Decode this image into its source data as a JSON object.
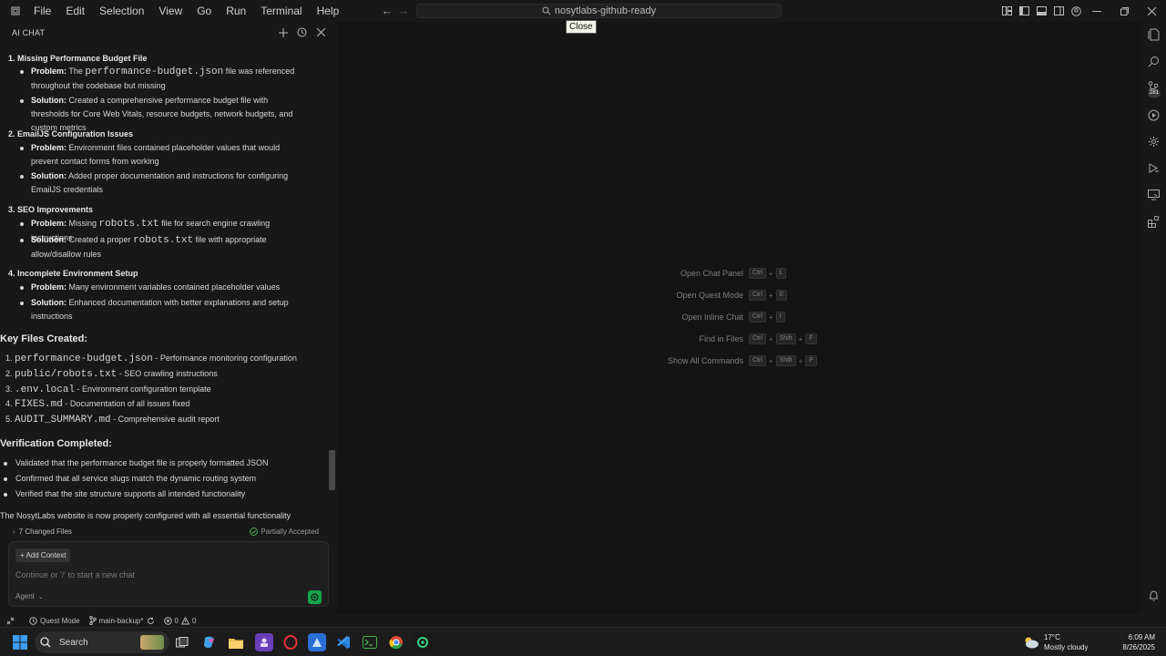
{
  "menu": [
    "File",
    "Edit",
    "Selection",
    "View",
    "Go",
    "Run",
    "Terminal",
    "Help"
  ],
  "search": {
    "text": "nosytlabs-github-ready"
  },
  "tooltip": "Close",
  "chat": {
    "header": "AI CHAT",
    "issues": [
      {
        "num": "1.",
        "title": "Missing Performance Budget File",
        "problem_label": "Problem:",
        "problem_pre": "The ",
        "problem_code": "performance-budget.json",
        "problem_post": " file was referenced throughout the codebase but missing",
        "solution_label": "Solution:",
        "solution": "Created a comprehensive performance budget file with thresholds for Core Web Vitals, resource budgets, network budgets, and custom metrics"
      },
      {
        "num": "2.",
        "title": "EmailJS Configuration Issues",
        "problem_label": "Problem:",
        "problem_pre": "Environment files contained placeholder values that would prevent contact forms from working",
        "problem_code": "",
        "problem_post": "",
        "solution_label": "Solution:",
        "solution": "Added proper documentation and instructions for configuring EmailJS credentials"
      },
      {
        "num": "3.",
        "title": "SEO Improvements",
        "problem_label": "Problem:",
        "problem_pre": "Missing ",
        "problem_code": "robots.txt",
        "problem_post": " file for search engine crawling instructions",
        "solution_label": "Solution:",
        "solution_pre": "Created a proper ",
        "solution_code": "robots.txt",
        "solution_post": " file with appropriate allow/disallow rules"
      },
      {
        "num": "4.",
        "title": "Incomplete Environment Setup",
        "problem_label": "Problem:",
        "problem_pre": "Many environment variables contained placeholder values",
        "problem_code": "",
        "problem_post": "",
        "solution_label": "Solution:",
        "solution": "Enhanced documentation with better explanations and setup instructions"
      }
    ],
    "key_files_title": "Key Files Created:",
    "key_files": [
      {
        "num": "1.",
        "code": "performance-budget.json",
        "desc": " - Performance monitoring configuration"
      },
      {
        "num": "2.",
        "code": "public/robots.txt",
        "desc": " - SEO crawling instructions"
      },
      {
        "num": "3.",
        "code": ".env.local",
        "desc": " - Environment configuration template"
      },
      {
        "num": "4.",
        "code": "FIXES.md",
        "desc": " - Documentation of all issues fixed"
      },
      {
        "num": "5.",
        "code": "AUDIT_SUMMARY.md",
        "desc": " - Comprehensive audit report"
      }
    ],
    "verification_title": "Verification Completed:",
    "verification": [
      "Validated that the performance budget file is properly formatted JSON",
      "Confirmed that all service slugs match the dynamic routing system",
      "Verified that the site structure supports all intended functionality"
    ],
    "closing": "The NosytLabs website is now properly configured with all essential functionality",
    "changed_files": "7 Changed Files",
    "changed_status": "Partially Accepted",
    "add_context": "+ Add Context",
    "input_placeholder": "Continue or '/' to start a new chat",
    "agent": "Agent"
  },
  "hints": [
    {
      "label": "Open Chat Panel",
      "keys": [
        "Ctrl",
        "L"
      ]
    },
    {
      "label": "Open Quest Mode",
      "keys": [
        "Ctrl",
        "E"
      ]
    },
    {
      "label": "Open Inline Chat",
      "keys": [
        "Ctrl",
        "I"
      ]
    },
    {
      "label": "Find in Files",
      "keys": [
        "Ctrl",
        "Shift",
        "F"
      ]
    },
    {
      "label": "Show All Commands",
      "keys": [
        "Ctrl",
        "Shift",
        "P"
      ]
    }
  ],
  "activity_badge": "281",
  "status": {
    "quest": "Quest Mode",
    "branch": "main-backup*",
    "errors": "0",
    "warnings": "0"
  },
  "taskbar": {
    "search": "Search",
    "temp": "17°C",
    "weather": "Mostly cloudy",
    "time": "6:09 AM",
    "date": "8/26/2025"
  },
  "colors": {
    "accent_green": "#16a34a",
    "background": "#141414",
    "panel": "#181818"
  }
}
